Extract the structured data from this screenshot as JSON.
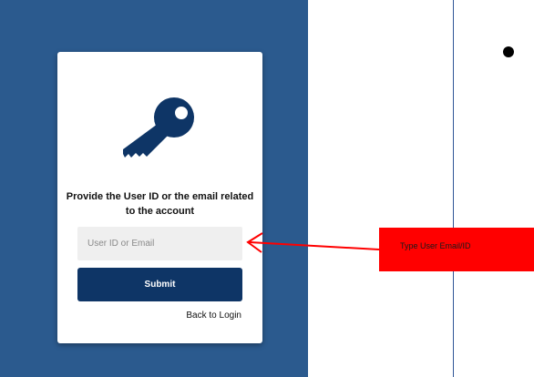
{
  "colors": {
    "screen_background": "#2b5a8e",
    "card_background": "#ffffff",
    "key_icon": "#0e3566",
    "submit_background": "#0e3566",
    "annotation_red": "#ff0000",
    "divider": "#2f5597"
  },
  "card": {
    "icon": "key-icon",
    "title": "Provide the User ID or the email related to the account",
    "input_placeholder": "User ID or Email",
    "input_value": "",
    "submit_label": "Submit",
    "back_label": "Back to Login"
  },
  "annotation": {
    "arrow_icon": "arrow-left-icon",
    "callout_text": "Type User Email/ID"
  },
  "slide": {
    "bullet_icon": "bullet-dot-icon"
  }
}
